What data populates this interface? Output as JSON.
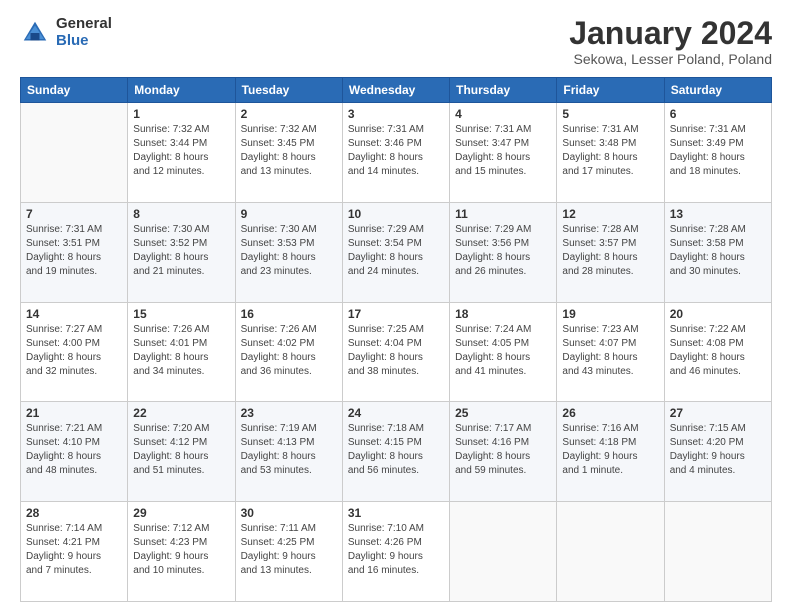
{
  "logo": {
    "general": "General",
    "blue": "Blue"
  },
  "title": "January 2024",
  "subtitle": "Sekowa, Lesser Poland, Poland",
  "headers": [
    "Sunday",
    "Monday",
    "Tuesday",
    "Wednesday",
    "Thursday",
    "Friday",
    "Saturday"
  ],
  "weeks": [
    [
      {
        "day": "",
        "info": ""
      },
      {
        "day": "1",
        "info": "Sunrise: 7:32 AM\nSunset: 3:44 PM\nDaylight: 8 hours\nand 12 minutes."
      },
      {
        "day": "2",
        "info": "Sunrise: 7:32 AM\nSunset: 3:45 PM\nDaylight: 8 hours\nand 13 minutes."
      },
      {
        "day": "3",
        "info": "Sunrise: 7:31 AM\nSunset: 3:46 PM\nDaylight: 8 hours\nand 14 minutes."
      },
      {
        "day": "4",
        "info": "Sunrise: 7:31 AM\nSunset: 3:47 PM\nDaylight: 8 hours\nand 15 minutes."
      },
      {
        "day": "5",
        "info": "Sunrise: 7:31 AM\nSunset: 3:48 PM\nDaylight: 8 hours\nand 17 minutes."
      },
      {
        "day": "6",
        "info": "Sunrise: 7:31 AM\nSunset: 3:49 PM\nDaylight: 8 hours\nand 18 minutes."
      }
    ],
    [
      {
        "day": "7",
        "info": "Sunrise: 7:31 AM\nSunset: 3:51 PM\nDaylight: 8 hours\nand 19 minutes."
      },
      {
        "day": "8",
        "info": "Sunrise: 7:30 AM\nSunset: 3:52 PM\nDaylight: 8 hours\nand 21 minutes."
      },
      {
        "day": "9",
        "info": "Sunrise: 7:30 AM\nSunset: 3:53 PM\nDaylight: 8 hours\nand 23 minutes."
      },
      {
        "day": "10",
        "info": "Sunrise: 7:29 AM\nSunset: 3:54 PM\nDaylight: 8 hours\nand 24 minutes."
      },
      {
        "day": "11",
        "info": "Sunrise: 7:29 AM\nSunset: 3:56 PM\nDaylight: 8 hours\nand 26 minutes."
      },
      {
        "day": "12",
        "info": "Sunrise: 7:28 AM\nSunset: 3:57 PM\nDaylight: 8 hours\nand 28 minutes."
      },
      {
        "day": "13",
        "info": "Sunrise: 7:28 AM\nSunset: 3:58 PM\nDaylight: 8 hours\nand 30 minutes."
      }
    ],
    [
      {
        "day": "14",
        "info": "Sunrise: 7:27 AM\nSunset: 4:00 PM\nDaylight: 8 hours\nand 32 minutes."
      },
      {
        "day": "15",
        "info": "Sunrise: 7:26 AM\nSunset: 4:01 PM\nDaylight: 8 hours\nand 34 minutes."
      },
      {
        "day": "16",
        "info": "Sunrise: 7:26 AM\nSunset: 4:02 PM\nDaylight: 8 hours\nand 36 minutes."
      },
      {
        "day": "17",
        "info": "Sunrise: 7:25 AM\nSunset: 4:04 PM\nDaylight: 8 hours\nand 38 minutes."
      },
      {
        "day": "18",
        "info": "Sunrise: 7:24 AM\nSunset: 4:05 PM\nDaylight: 8 hours\nand 41 minutes."
      },
      {
        "day": "19",
        "info": "Sunrise: 7:23 AM\nSunset: 4:07 PM\nDaylight: 8 hours\nand 43 minutes."
      },
      {
        "day": "20",
        "info": "Sunrise: 7:22 AM\nSunset: 4:08 PM\nDaylight: 8 hours\nand 46 minutes."
      }
    ],
    [
      {
        "day": "21",
        "info": "Sunrise: 7:21 AM\nSunset: 4:10 PM\nDaylight: 8 hours\nand 48 minutes."
      },
      {
        "day": "22",
        "info": "Sunrise: 7:20 AM\nSunset: 4:12 PM\nDaylight: 8 hours\nand 51 minutes."
      },
      {
        "day": "23",
        "info": "Sunrise: 7:19 AM\nSunset: 4:13 PM\nDaylight: 8 hours\nand 53 minutes."
      },
      {
        "day": "24",
        "info": "Sunrise: 7:18 AM\nSunset: 4:15 PM\nDaylight: 8 hours\nand 56 minutes."
      },
      {
        "day": "25",
        "info": "Sunrise: 7:17 AM\nSunset: 4:16 PM\nDaylight: 8 hours\nand 59 minutes."
      },
      {
        "day": "26",
        "info": "Sunrise: 7:16 AM\nSunset: 4:18 PM\nDaylight: 9 hours\nand 1 minute."
      },
      {
        "day": "27",
        "info": "Sunrise: 7:15 AM\nSunset: 4:20 PM\nDaylight: 9 hours\nand 4 minutes."
      }
    ],
    [
      {
        "day": "28",
        "info": "Sunrise: 7:14 AM\nSunset: 4:21 PM\nDaylight: 9 hours\nand 7 minutes."
      },
      {
        "day": "29",
        "info": "Sunrise: 7:12 AM\nSunset: 4:23 PM\nDaylight: 9 hours\nand 10 minutes."
      },
      {
        "day": "30",
        "info": "Sunrise: 7:11 AM\nSunset: 4:25 PM\nDaylight: 9 hours\nand 13 minutes."
      },
      {
        "day": "31",
        "info": "Sunrise: 7:10 AM\nSunset: 4:26 PM\nDaylight: 9 hours\nand 16 minutes."
      },
      {
        "day": "",
        "info": ""
      },
      {
        "day": "",
        "info": ""
      },
      {
        "day": "",
        "info": ""
      }
    ]
  ]
}
